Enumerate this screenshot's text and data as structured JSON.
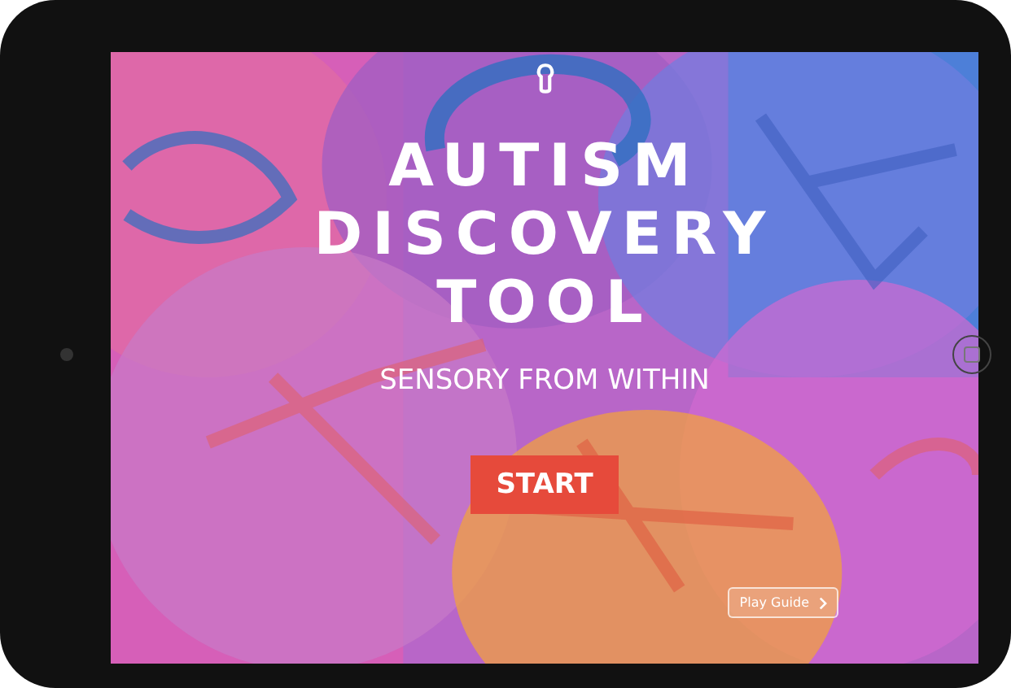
{
  "app": {
    "title_lines": [
      "AUTISM",
      "DISCOVERY",
      "TOOL"
    ],
    "subtitle": "SENSORY FROM WITHIN",
    "start_button": "START",
    "guide_button": "Play Guide"
  }
}
